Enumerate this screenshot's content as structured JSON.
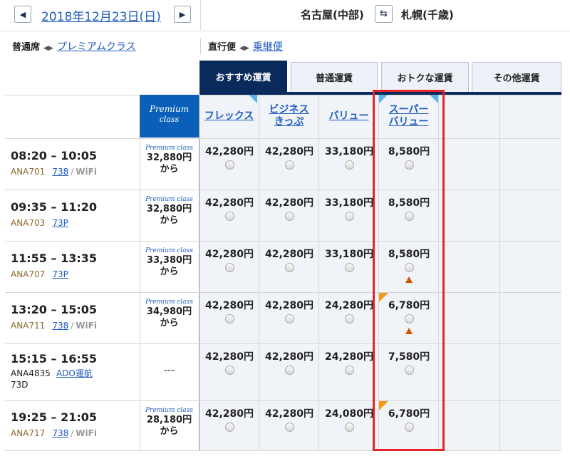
{
  "header": {
    "date": "2018年12月23日(日)",
    "origin": "名古屋(中部)",
    "destination": "札幌(千歳)"
  },
  "options": {
    "seat_current": "普通席",
    "seat_link": "プレミアムクラス",
    "route_current": "直行便",
    "route_link": "乗継便"
  },
  "tabs": [
    "おすすめ運賃",
    "普通運賃",
    "おトクな運賃",
    "その他運賃"
  ],
  "columns": {
    "premium_line1": "Premium",
    "premium_line2": "class",
    "flex": "フレックス",
    "business_1": "ビジネス",
    "business_2": "きっぷ",
    "value": "バリュー",
    "super_1": "スーパー",
    "super_2": "バリュー"
  },
  "premium_label": "Premium class",
  "from_label": "から",
  "flights": [
    {
      "time": "08:20 – 10:05",
      "number": "ANA701",
      "aircraft": "738",
      "wifi": "WiFi",
      "premium": "32,880円",
      "flex": "42,280円",
      "business": "42,280円",
      "value": "33,180円",
      "super": "8,580円"
    },
    {
      "time": "09:35 – 11:20",
      "number": "ANA703",
      "aircraft": "73P",
      "premium": "32,880円",
      "flex": "42,280円",
      "business": "42,280円",
      "value": "33,180円",
      "super": "8,580円"
    },
    {
      "time": "11:55 – 13:35",
      "number": "ANA707",
      "aircraft": "73P",
      "premium": "33,380円",
      "flex": "42,280円",
      "business": "42,280円",
      "value": "33,180円",
      "super": "8,580円"
    },
    {
      "time": "13:20 – 15:05",
      "number": "ANA711",
      "aircraft": "738",
      "wifi": "WiFi",
      "premium": "34,980円",
      "flex": "42,280円",
      "business": "42,280円",
      "value": "24,280円",
      "super": "6,780円"
    },
    {
      "time": "15:15 – 16:55",
      "number": "ANA4835",
      "operator": "ADO運航",
      "aircraft": "73D",
      "premium": "---",
      "flex": "42,280円",
      "business": "42,280円",
      "value": "24,280円",
      "super": "7,580円"
    },
    {
      "time": "19:25 – 21:05",
      "number": "ANA717",
      "aircraft": "738",
      "wifi": "WiFi",
      "premium": "28,180円",
      "flex": "42,280円",
      "business": "42,280円",
      "value": "24,080円",
      "super": "6,780円"
    }
  ],
  "colors": {
    "navy": "#0b2a5c",
    "premium_blue": "#0a60b8",
    "link": "#1f5bbf",
    "highlight": "#e5252a",
    "warning": "#d35400"
  }
}
